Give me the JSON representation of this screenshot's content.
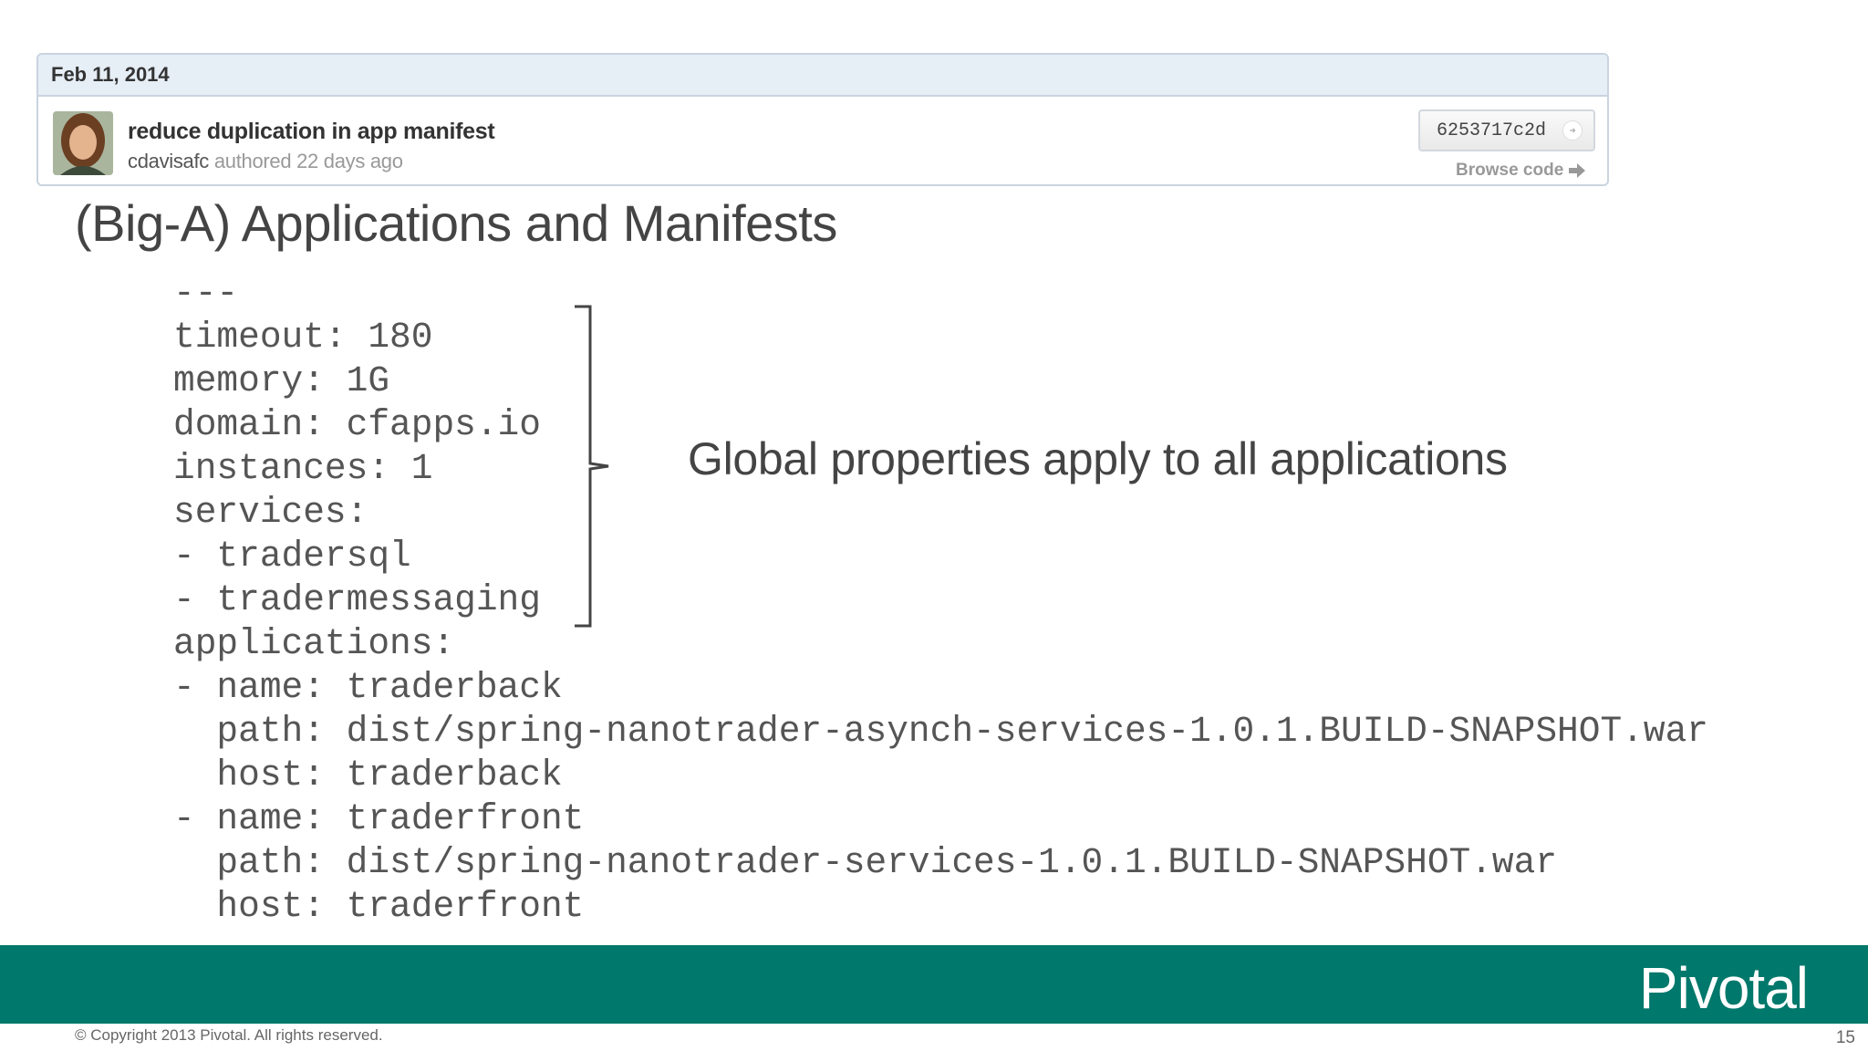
{
  "commit": {
    "date": "Feb 11, 2014",
    "message": "reduce duplication in app manifest",
    "author": "cdavisafc",
    "authored_text": " authored 22 days ago",
    "sha": "6253717c2d",
    "browse_label": "Browse code"
  },
  "slide": {
    "title": "(Big-A) Applications and Manifests",
    "code_lines": [
      "---",
      "timeout: 180",
      "memory: 1G",
      "domain: cfapps.io",
      "instances: 1",
      "services:",
      "- tradersql",
      "- tradermessaging",
      "applications:",
      "- name: traderback",
      "  path: dist/spring-nanotrader-asynch-services-1.0.1.BUILD-SNAPSHOT.war",
      "  host: traderback",
      "- name: traderfront",
      "  path: dist/spring-nanotrader-services-1.0.1.BUILD-SNAPSHOT.war",
      "  host: traderfront"
    ],
    "annotation": "Global properties apply to all applications"
  },
  "footer": {
    "logo": "Pivotal",
    "copyright": "© Copyright 2013 Pivotal. All rights reserved.",
    "page_number": "15"
  },
  "colors": {
    "band": "#00786b",
    "header_bg": "#e6eef6"
  }
}
